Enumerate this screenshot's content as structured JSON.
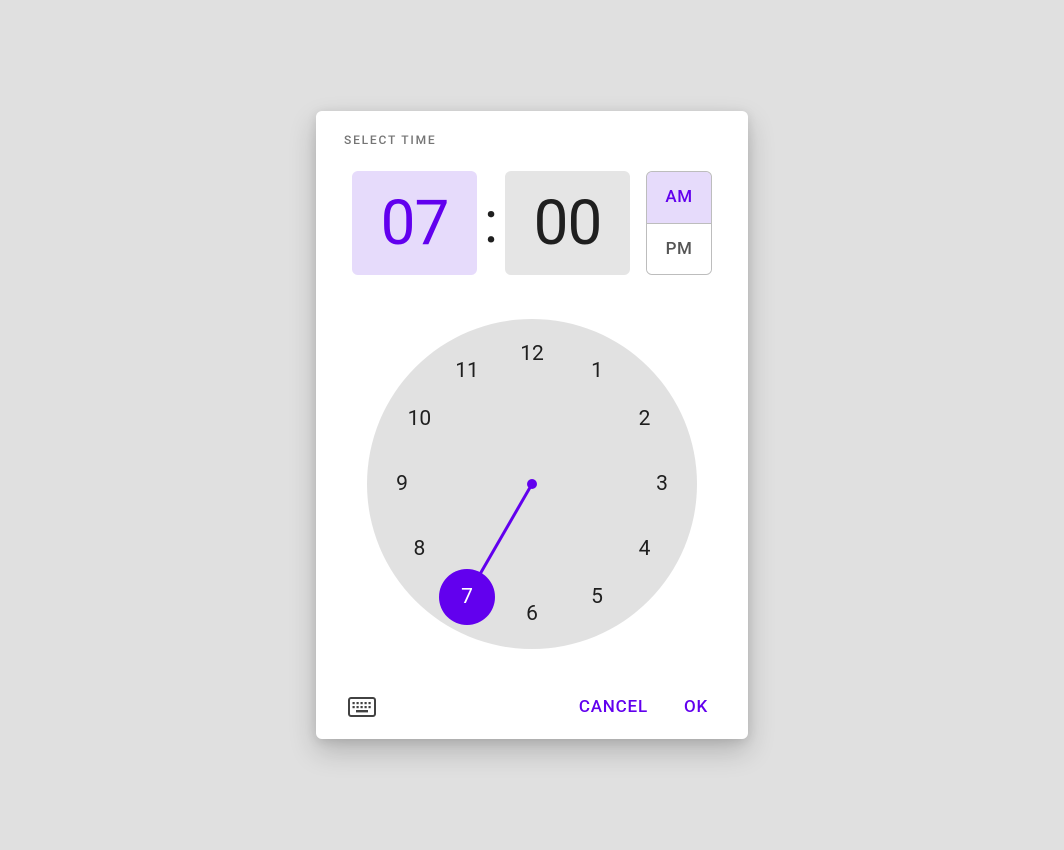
{
  "title": "SELECT TIME",
  "time": {
    "hour_display": "07",
    "minute_display": "00",
    "separator": ":",
    "selected_hour": 7,
    "active_field": "hour"
  },
  "ampm": {
    "am_label": "AM",
    "pm_label": "PM",
    "selected": "AM"
  },
  "clock": {
    "labels": [
      "12",
      "1",
      "2",
      "3",
      "4",
      "5",
      "6",
      "7",
      "8",
      "9",
      "10",
      "11"
    ]
  },
  "actions": {
    "cancel": "CANCEL",
    "ok": "OK"
  },
  "colors": {
    "primary": "#6200EE",
    "primary_light": "#e6dbfb",
    "surface": "#ffffff",
    "background": "#e0e0e0",
    "neutral_box": "#e5e5e5"
  }
}
